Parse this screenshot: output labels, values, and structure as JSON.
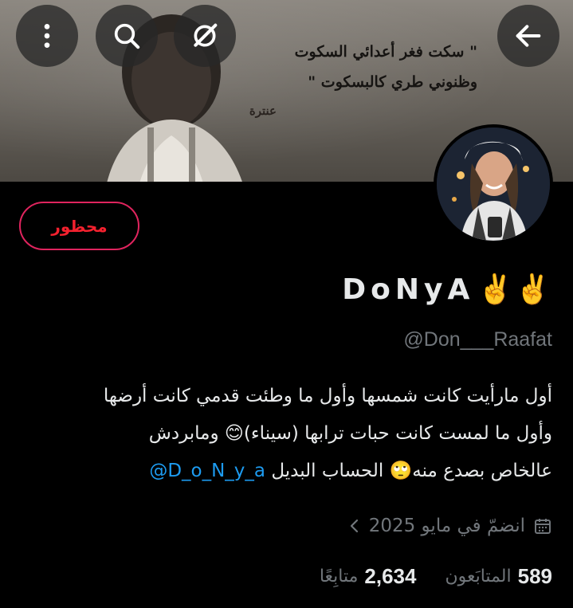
{
  "banner": {
    "quote_line1": "\" سكت فغر أعدائي السكوت",
    "quote_line2": "وظنوني طري كالبسكوت \"",
    "author": "عنترة"
  },
  "toolbar": {
    "back_icon": "arrow-left-icon",
    "grok_icon": "grok-icon",
    "search_icon": "search-icon",
    "more_icon": "more-vertical-icon"
  },
  "profile": {
    "blocked_label": "محظور",
    "display_name": "DoNyA",
    "name_emoji": "✌️✌️",
    "handle": "@Don___Raafat",
    "bio_line1": "أول مارأيت كانت شمسها وأول ما وطئت قدمي كانت أرضها",
    "bio_line2": "وأول ما لمست كانت حبات ترابها (سيناء)😊 ومابردش",
    "bio_line3": "عالخاص بصدع منه🙄 الحساب البديل",
    "bio_mention": "@D_o_N_y_a",
    "joined": "انضمّ في مايو 2025",
    "following_count": "589",
    "following_label": "المتابَعون",
    "followers_count": "2,634",
    "followers_label": "متابِعًا"
  },
  "colors": {
    "accent": "#1d9bf0",
    "blocked": "#f4212e",
    "muted": "#71767b"
  }
}
